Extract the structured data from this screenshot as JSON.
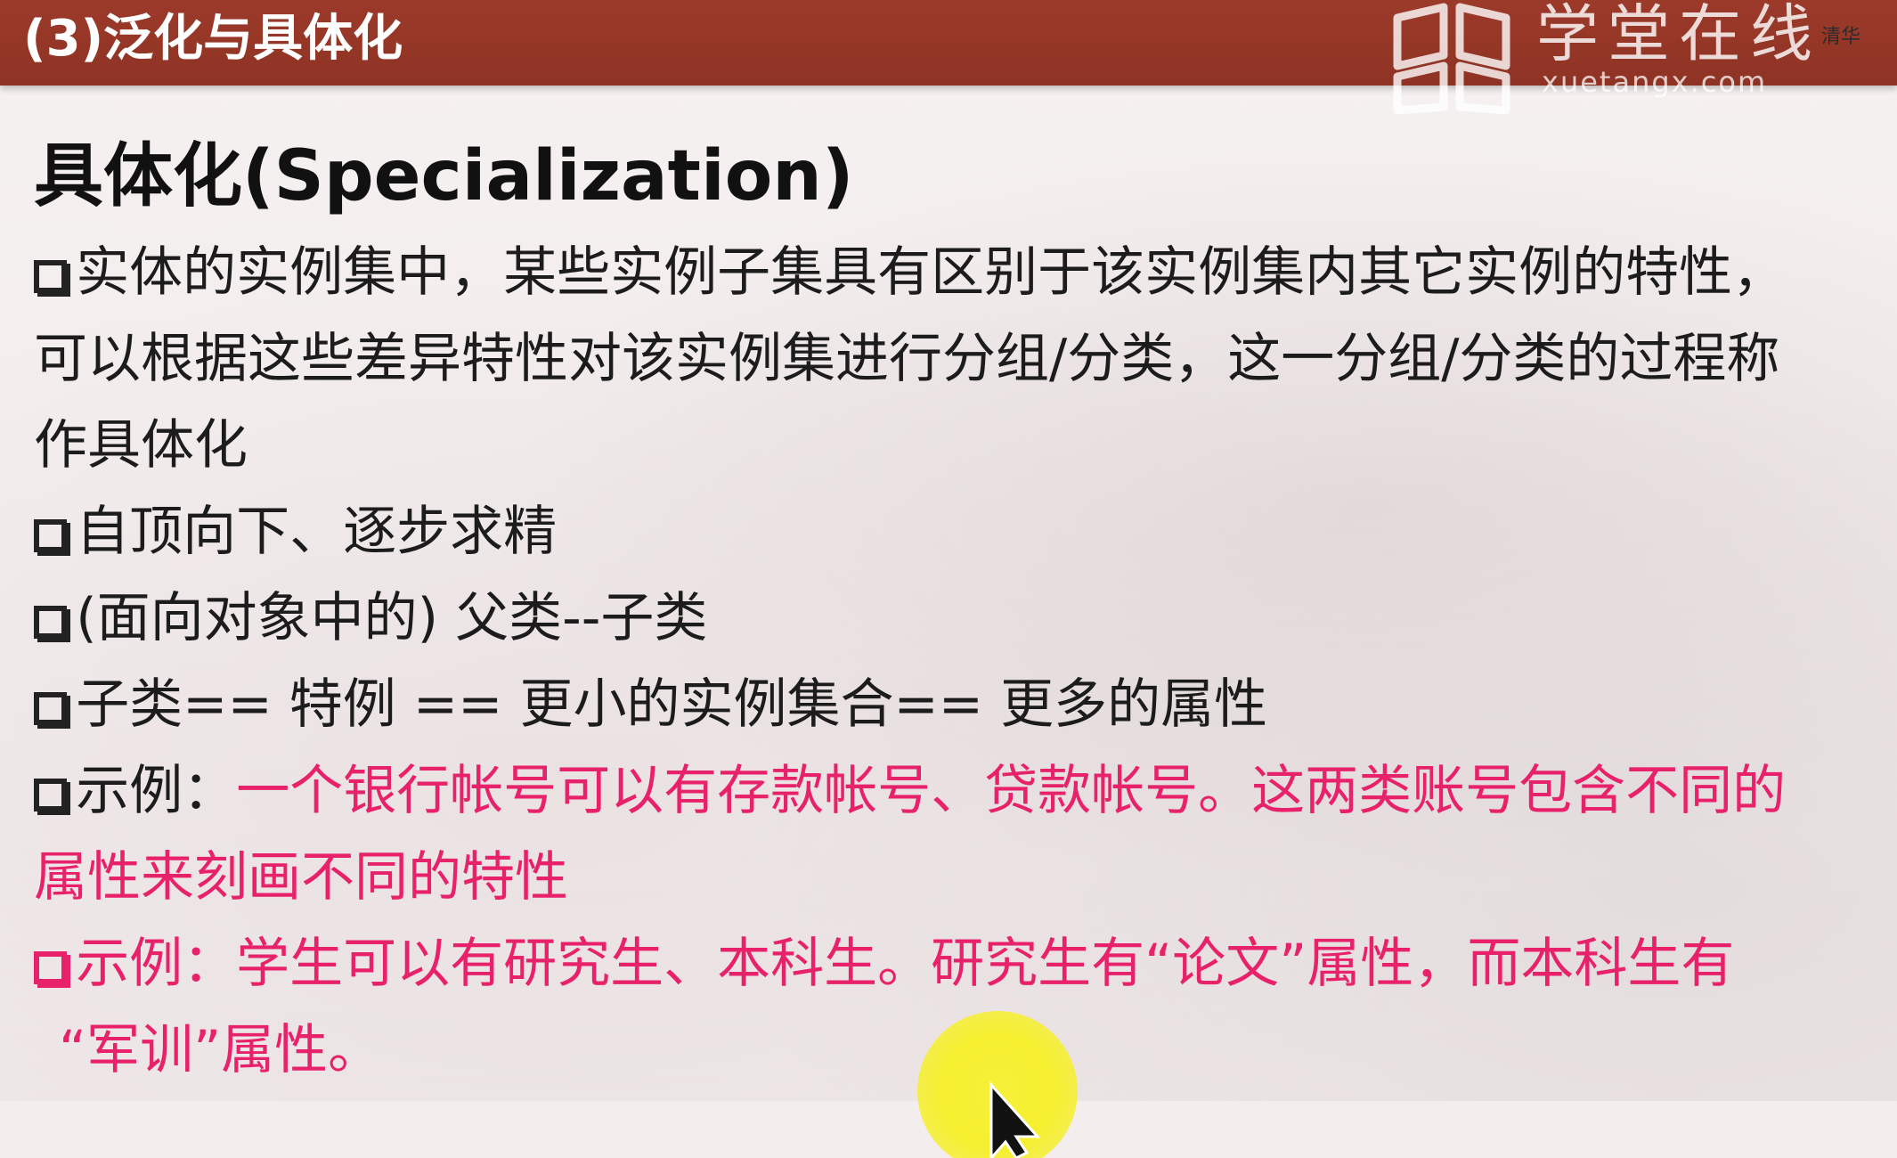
{
  "header": {
    "title": "(3)泛化与具体化",
    "logo_name": "学堂在线",
    "logo_domain": "xuetangx.com",
    "logo_badge": "清华"
  },
  "slide": {
    "heading": "具体化(Specialization)",
    "lines": [
      "实体的实例集中，某些实例子集具有区别于该实例集内其它实例的特性，",
      "可以根据这些差异特性对该实例集进行分组/分类，这一分组/分类的过程称",
      "作具体化",
      "自顶向下、逐步求精",
      "(面向对象中的) 父类--子类",
      "子类== 特例 == 更小的实例集合== 更多的属性"
    ],
    "example1_label": "示例：",
    "example1_text": "一个银行帐号可以有存款帐号、贷款帐号。这两类账号包含不同的",
    "example1_cont": "属性来刻画不同的特性",
    "example2_line1": "示例：学生可以有研究生、本科生。研究生有“论文”属性，而本科生有",
    "example2_line2": "“军训”属性。"
  },
  "colors": {
    "title_bar": "#9c3a2a",
    "highlight_text": "#e8226a",
    "body_text": "#1c1c1c",
    "cursor_highlight": "#f5ef2f"
  },
  "icons": {
    "bullet": "hollow-square-bullet-icon",
    "logo": "book-logo-icon",
    "cursor": "mouse-pointer-icon"
  }
}
